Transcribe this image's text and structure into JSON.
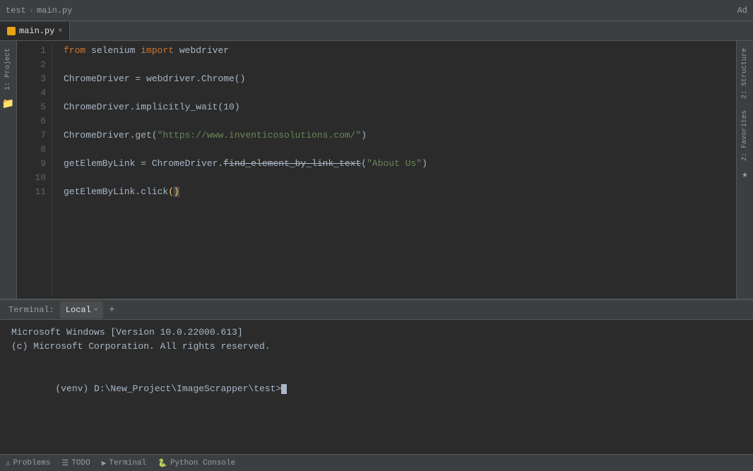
{
  "topbar": {
    "breadcrumb_project": "test",
    "breadcrumb_file": "main.py",
    "right_label": "Ad"
  },
  "tab": {
    "label": "main.py",
    "close": "×"
  },
  "code": {
    "lines": [
      {
        "num": 1,
        "content": "from selenium import webdriver",
        "tokens": [
          {
            "t": "kw",
            "v": "from"
          },
          {
            "t": "plain",
            "v": " selenium "
          },
          {
            "t": "kw",
            "v": "import"
          },
          {
            "t": "plain",
            "v": " webdriver"
          }
        ]
      },
      {
        "num": 2,
        "content": "",
        "tokens": []
      },
      {
        "num": 3,
        "content": "ChromeDriver = webdriver.Chrome()",
        "tokens": [
          {
            "t": "plain",
            "v": "ChromeDriver = webdriver.Chrome()"
          }
        ]
      },
      {
        "num": 4,
        "content": "",
        "tokens": []
      },
      {
        "num": 5,
        "content": "ChromeDriver.implicitly_wait(10)",
        "tokens": [
          {
            "t": "plain",
            "v": "ChromeDriver.implicitly_wait(10)"
          }
        ]
      },
      {
        "num": 6,
        "content": "",
        "tokens": []
      },
      {
        "num": 7,
        "content": "ChromeDriver.get(\"https://www.inventicosolutions.com/\")",
        "tokens": [
          {
            "t": "plain",
            "v": "ChromeDriver.get("
          },
          {
            "t": "str",
            "v": "\"https://www.inventicosolutions.com/\""
          },
          {
            "t": "plain",
            "v": ")"
          }
        ]
      },
      {
        "num": 8,
        "content": "",
        "tokens": []
      },
      {
        "num": 9,
        "content": "getElemByLink = ChromeDriver.find_element_by_link_text(\"About Us\")",
        "tokens": [
          {
            "t": "plain",
            "v": "getElemByLink = ChromeDriver."
          },
          {
            "t": "strikethrough",
            "v": "find_element_by_link_text"
          },
          {
            "t": "plain",
            "v": "("
          },
          {
            "t": "str",
            "v": "\"About Us\""
          },
          {
            "t": "plain",
            "v": ")"
          }
        ]
      },
      {
        "num": 10,
        "content": "",
        "tokens": []
      },
      {
        "num": 11,
        "content": "getElemByLink.click()",
        "tokens": [
          {
            "t": "plain",
            "v": "getElemByLink.click"
          },
          {
            "t": "paren",
            "v": "()"
          }
        ]
      }
    ]
  },
  "left_sidebar": {
    "project_label": "1: Project",
    "structure_label": "2: Structure",
    "favorites_label": "2: Favorites"
  },
  "panel": {
    "tab_label": "Terminal:",
    "local_tab": "Local",
    "close": "×",
    "plus": "+",
    "terminal_line1": "Microsoft Windows [Version 10.0.22000.613]",
    "terminal_line2": "(c) Microsoft Corporation. All rights reserved.",
    "terminal_line3": "",
    "terminal_prompt": "(venv) D:\\New_Project\\ImageScrapper\\test>"
  },
  "statusbar": {
    "problems_icon": "⚠",
    "problems_label": "Problems",
    "todo_icon": "☰",
    "todo_label": "TODO",
    "terminal_icon": "▶",
    "terminal_label": "Terminal",
    "python_console_icon": "🐍",
    "python_console_label": "Python Console"
  }
}
